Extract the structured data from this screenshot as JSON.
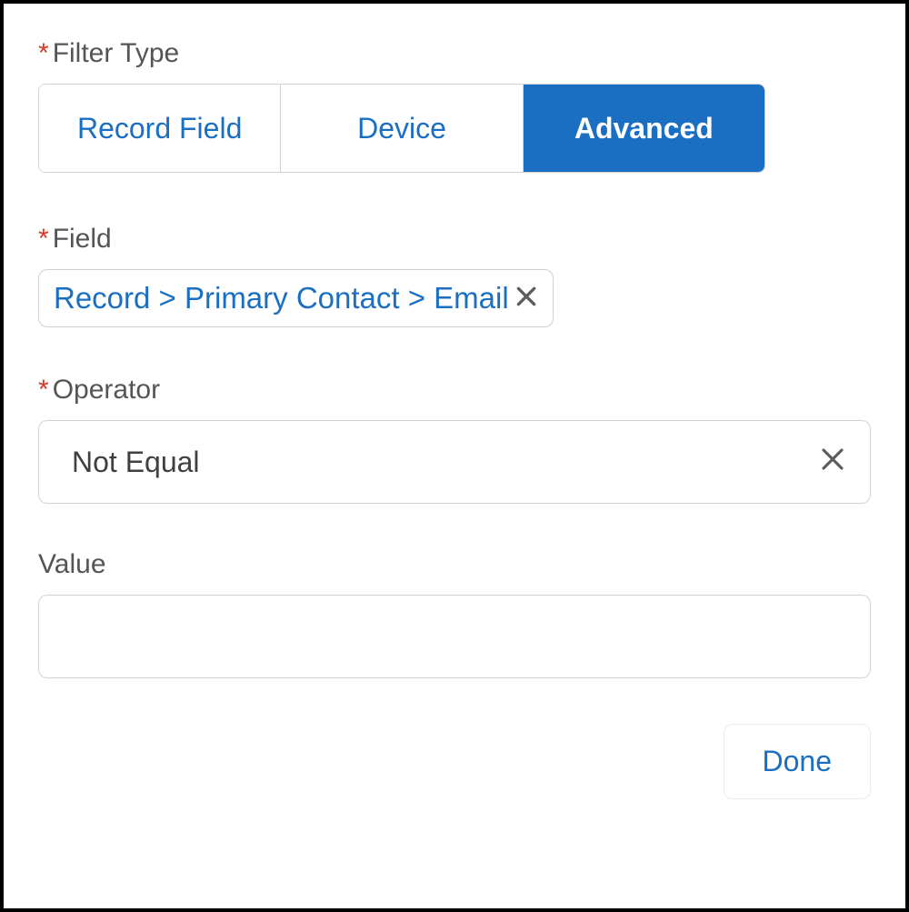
{
  "filterType": {
    "label": "Filter Type",
    "required": true,
    "options": {
      "recordField": "Record Field",
      "device": "Device",
      "advanced": "Advanced"
    },
    "selected": "advanced"
  },
  "field": {
    "label": "Field",
    "required": true,
    "value": "Record > Primary Contact > Email"
  },
  "operator": {
    "label": "Operator",
    "required": true,
    "value": "Not Equal"
  },
  "value": {
    "label": "Value",
    "required": false,
    "value": ""
  },
  "actions": {
    "done": "Done"
  }
}
